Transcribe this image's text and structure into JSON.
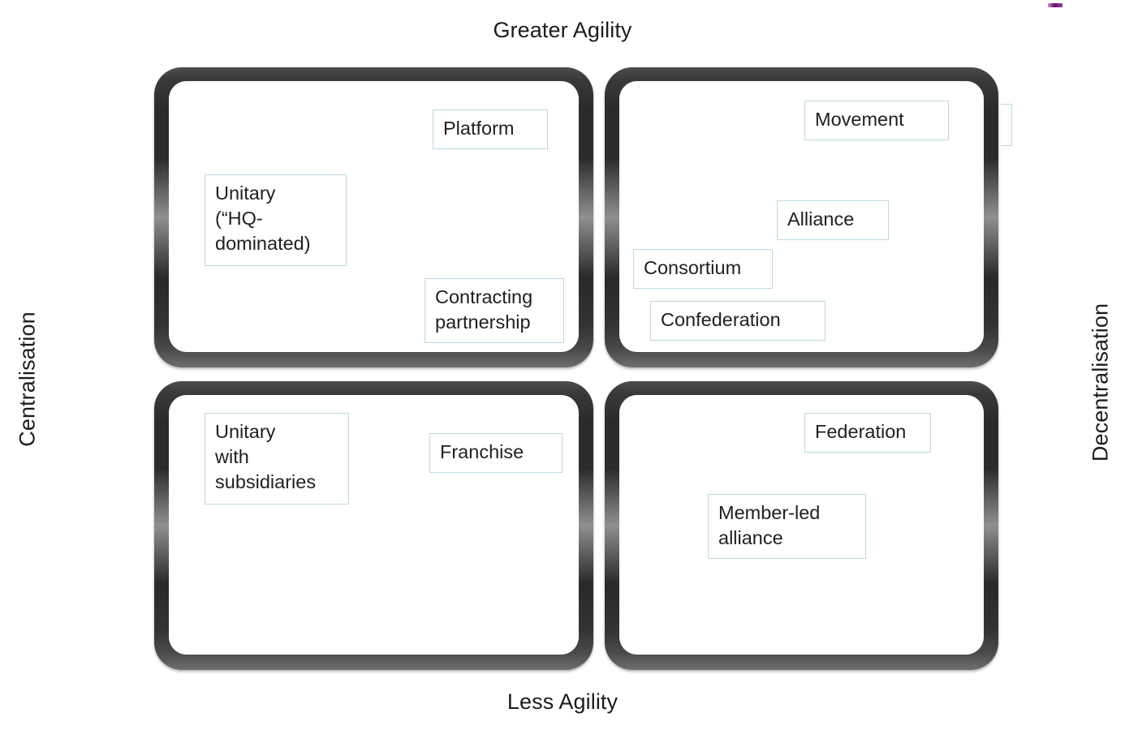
{
  "axes": {
    "top_label": "Greater Agility",
    "bottom_label": "Less Agility",
    "left_label": "Centralisation",
    "right_label": "Decentralisation"
  },
  "colors": {
    "node_border": "#bcd8e0",
    "node_fill": "#ffffff",
    "frame_dark": "#2a2a2a",
    "corner_mark": "#5b1262",
    "text": "#1f1f1f"
  },
  "quadrants": [
    {
      "id": "centralised-greater-agility",
      "position": "top-left",
      "nodes": [
        {
          "label": "Platform"
        },
        {
          "label": "Unitary\n(“HQ-\ndominated)"
        },
        {
          "label": "Contracting\npartnership"
        }
      ]
    },
    {
      "id": "decentralised-greater-agility",
      "position": "top-right",
      "nodes": [
        {
          "label": "Movement"
        },
        {
          "label": "Alliance"
        },
        {
          "label": "Consortium"
        },
        {
          "label": "Confederation"
        }
      ]
    },
    {
      "id": "centralised-less-agility",
      "position": "bottom-left",
      "nodes": [
        {
          "label": "Unitary\nwith\nsubsidiaries"
        },
        {
          "label": "Franchise"
        }
      ]
    },
    {
      "id": "decentralised-less-agility",
      "position": "bottom-right",
      "nodes": [
        {
          "label": "Federation"
        },
        {
          "label": "Member-led\nalliance"
        }
      ]
    }
  ]
}
